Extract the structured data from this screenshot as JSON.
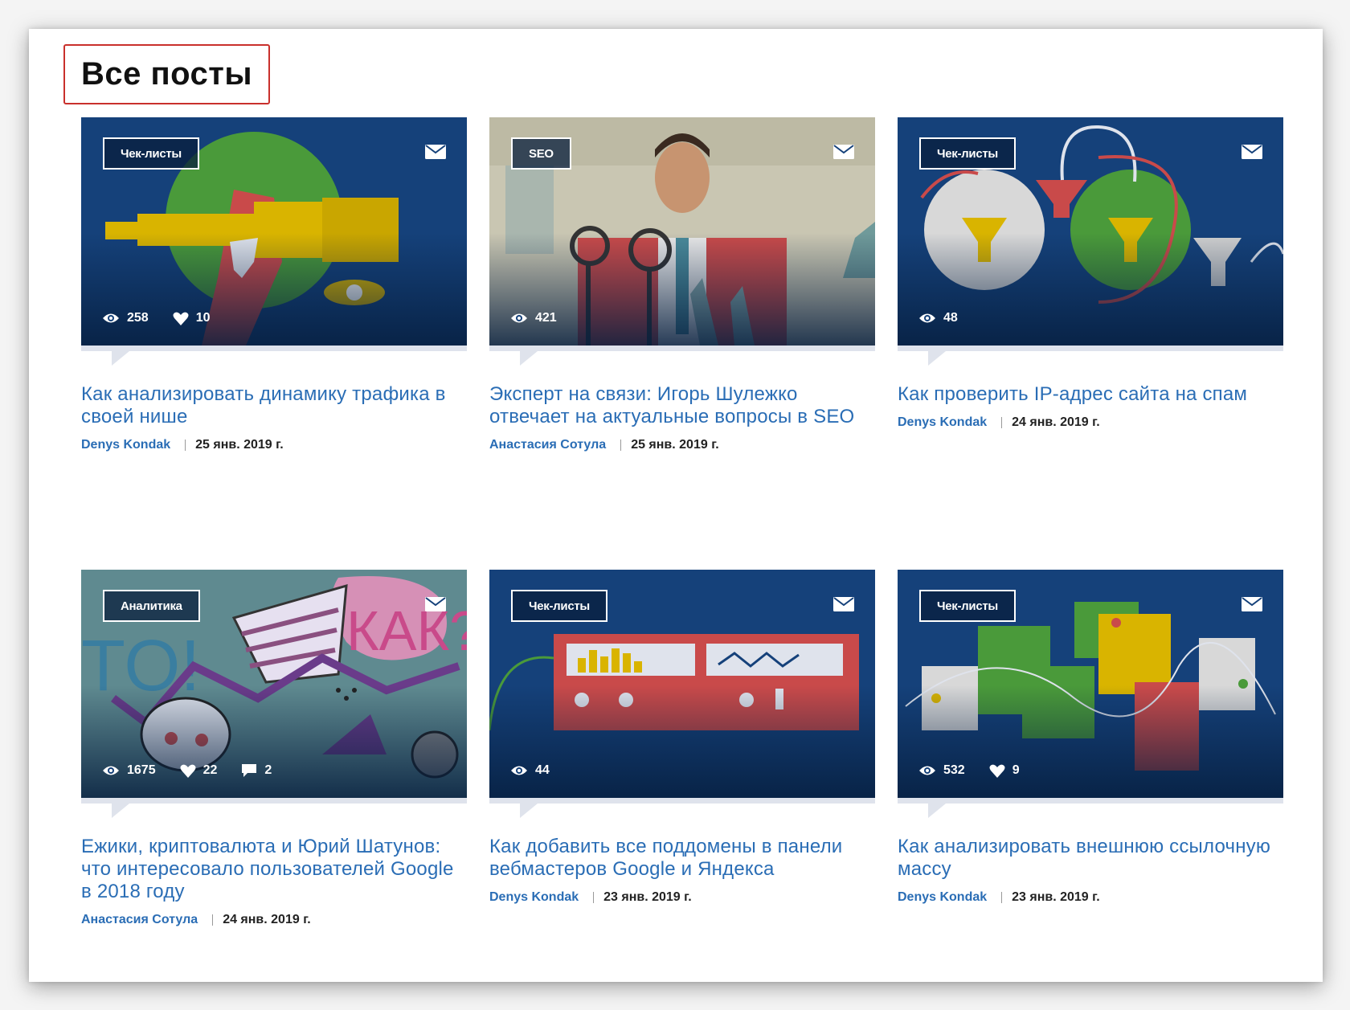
{
  "page": {
    "heading": "Все посты"
  },
  "posts": [
    {
      "tag": "Чек-листы",
      "views": "258",
      "likes": "10",
      "comments": "",
      "title": "Как анализировать динамику трафика в своей нише",
      "author": "Denys Kondak",
      "date": "25 янв. 2019 г.",
      "art": "telescope"
    },
    {
      "tag": "SEO",
      "views": "421",
      "likes": "",
      "comments": "",
      "title": "Эксперт на связи: Игорь Шулежко отвечает на актуальные вопросы в SEO",
      "author": "Анастасия Сотула",
      "date": "25 янв. 2019 г.",
      "art": "speaker"
    },
    {
      "tag": "Чек-листы",
      "views": "48",
      "likes": "",
      "comments": "",
      "title": "Как проверить IP-адрес сайта на спам",
      "author": "Denys Kondak",
      "date": "24 янв. 2019 г.",
      "art": "funnels"
    },
    {
      "tag": "Аналитика",
      "views": "1675",
      "likes": "22",
      "comments": "2",
      "title": "Ежики, криптовалюта и Юрий Шатунов: что интересовало пользователей Google в 2018 году",
      "author": "Анастасия Сотула",
      "date": "24 янв. 2019 г.",
      "art": "doodles"
    },
    {
      "tag": "Чек-листы",
      "views": "44",
      "likes": "",
      "comments": "",
      "title": "Как добавить все поддомены в панели вебмастеров Google и Яндекса",
      "author": "Denys Kondak",
      "date": "23 янв. 2019 г.",
      "art": "device"
    },
    {
      "tag": "Чек-листы",
      "views": "532",
      "likes": "9",
      "comments": "",
      "title": "Как анализировать внешнюю ссылочную массу",
      "author": "Denys Kondak",
      "date": "23 янв. 2019 г.",
      "art": "boxes"
    }
  ],
  "icons": {
    "views": "eye-icon",
    "likes": "heart-icon",
    "comments": "comment-icon",
    "share": "mail-icon"
  },
  "colors": {
    "accent": "#2a6db5",
    "thumb_bg": "#15417a",
    "heading_border": "#c9302c"
  }
}
